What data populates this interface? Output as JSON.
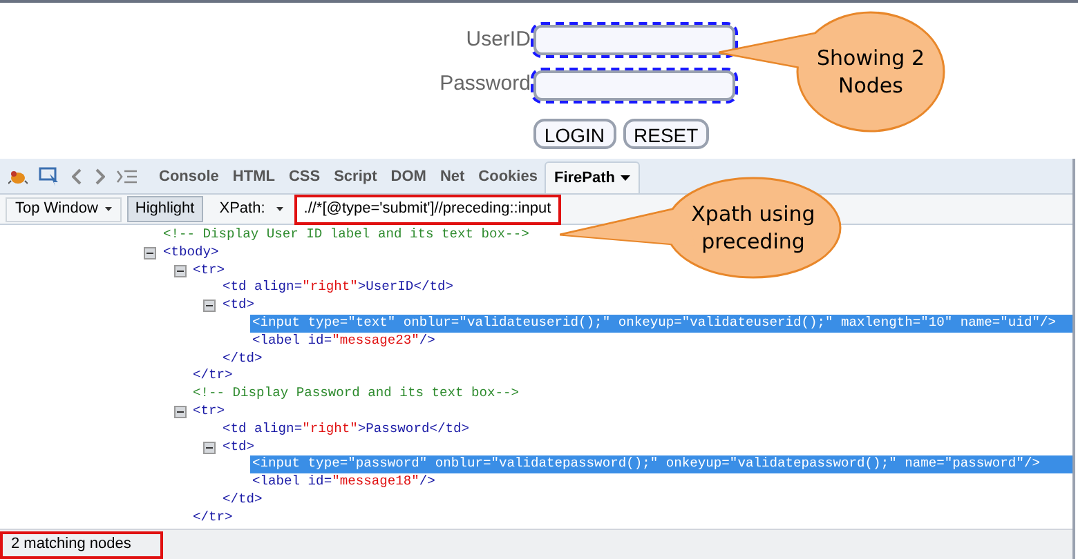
{
  "login_form": {
    "fields": [
      {
        "label": "UserID",
        "highlighted": true
      },
      {
        "label": "Password",
        "highlighted": true
      }
    ],
    "buttons": [
      "LOGIN",
      "RESET"
    ]
  },
  "callouts": [
    {
      "text": "Showing 2 Nodes"
    },
    {
      "text": "Xpath using preceding"
    }
  ],
  "devtools": {
    "tabs": [
      {
        "label": "Console",
        "selected": false
      },
      {
        "label": "HTML",
        "selected": false
      },
      {
        "label": "CSS",
        "selected": false
      },
      {
        "label": "Script",
        "selected": false
      },
      {
        "label": "DOM",
        "selected": false
      },
      {
        "label": "Net",
        "selected": false
      },
      {
        "label": "Cookies",
        "selected": false
      },
      {
        "label": "FirePath",
        "selected": true
      }
    ],
    "toolbar": {
      "frame_button": "Top Window",
      "highlight_button": {
        "label": "Highlight",
        "on": true
      },
      "xpath_label": "XPath:",
      "xpath_value": ".//*[@type='submit']//preceding::input",
      "xpath_annotated": true
    },
    "tree": [
      {
        "kind": "comment",
        "text": "<!-- Display User ID label and its text box-->"
      },
      {
        "kind": "element",
        "text": "<tbody>",
        "expanded": true,
        "children": [
          {
            "kind": "element",
            "text": "<tr>",
            "expanded": true,
            "closing": "</tr>",
            "children": [
              {
                "kind": "element",
                "text": "<td align=\"right\">UserID</td>"
              },
              {
                "kind": "element",
                "text": "<td>",
                "expanded": true,
                "closing": "</td>",
                "children": [
                  {
                    "kind": "element",
                    "text": "<input type=\"text\" onblur=\"validateuserid();\" onkeyup=\"validateuserid();\" maxlength=\"10\" name=\"uid\"/>",
                    "selected": true
                  },
                  {
                    "kind": "element",
                    "text": "<label id=\"message23\"/>",
                    "selected": false
                  }
                ]
              }
            ]
          },
          {
            "kind": "comment",
            "text": "<!-- Display Password and its text box-->"
          },
          {
            "kind": "element",
            "text": "<tr>",
            "expanded": true,
            "closing": "</tr>",
            "children": [
              {
                "kind": "element",
                "text": "<td align=\"right\">Password</td>"
              },
              {
                "kind": "element",
                "text": "<td>",
                "expanded": true,
                "closing": "</td>",
                "children": [
                  {
                    "kind": "element",
                    "text": "<input type=\"password\" onblur=\"validatepassword();\" onkeyup=\"validatepassword();\" name=\"password\"/>",
                    "selected": true
                  },
                  {
                    "kind": "element",
                    "text": "<label id=\"message18\"/>",
                    "selected": false
                  }
                ]
              }
            ]
          }
        ]
      }
    ],
    "status": {
      "text": "2 matching nodes",
      "annotated": true
    }
  }
}
